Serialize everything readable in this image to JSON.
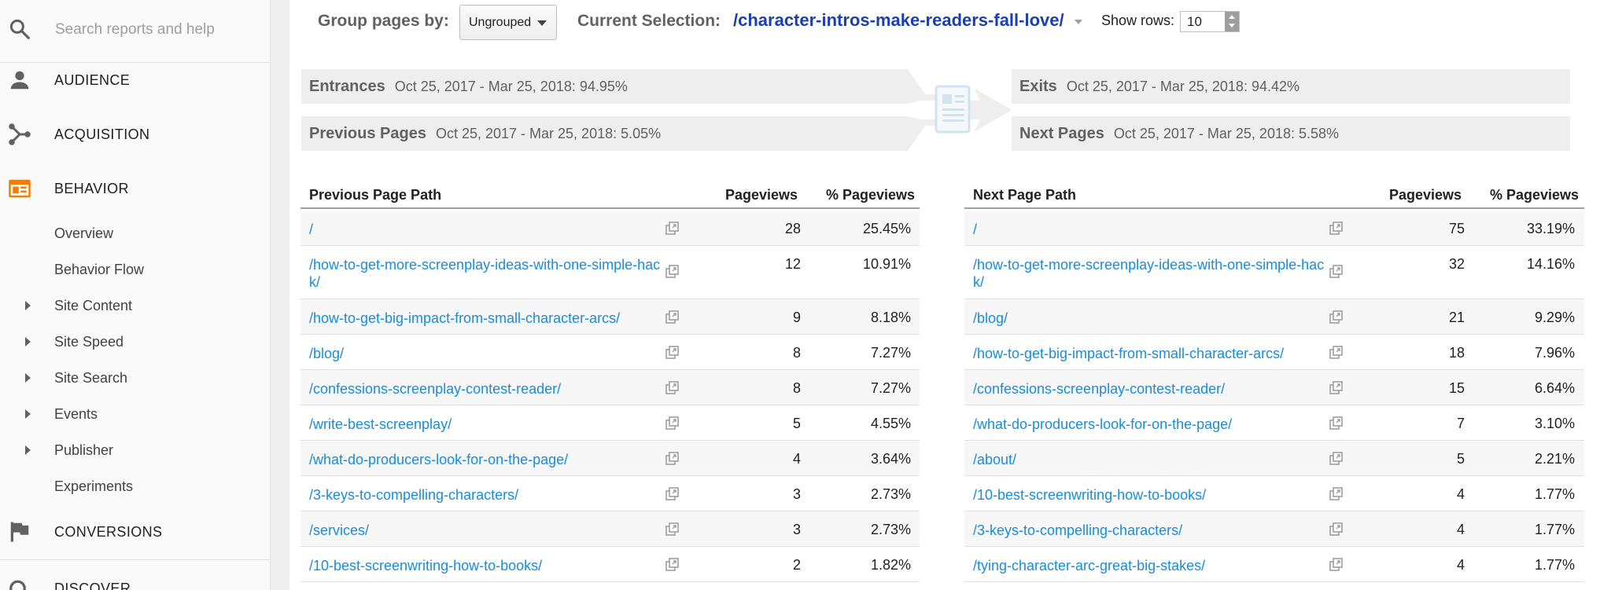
{
  "sidebar": {
    "search_placeholder": "Search reports and help",
    "sections": [
      {
        "label": "AUDIENCE"
      },
      {
        "label": "ACQUISITION"
      },
      {
        "label": "BEHAVIOR"
      },
      {
        "label": "CONVERSIONS"
      },
      {
        "label": "DISCOVER"
      }
    ],
    "behavior_items": [
      {
        "label": "Overview",
        "expandable": false
      },
      {
        "label": "Behavior Flow",
        "expandable": false
      },
      {
        "label": "Site Content",
        "expandable": true
      },
      {
        "label": "Site Speed",
        "expandable": true
      },
      {
        "label": "Site Search",
        "expandable": true
      },
      {
        "label": "Events",
        "expandable": true
      },
      {
        "label": "Publisher",
        "expandable": true
      },
      {
        "label": "Experiments",
        "expandable": false
      }
    ],
    "accent_color": "#f57c00"
  },
  "toolbar": {
    "group_label": "Group pages by:",
    "group_value": "Ungrouped",
    "current_label": "Current Selection:",
    "current_value": "/character-intros-make-readers-fall-love/",
    "rows_label": "Show rows:",
    "rows_value": "10"
  },
  "summary": {
    "entrances_title": "Entrances",
    "entrances_value": "Oct 25, 2017 - Mar 25, 2018: 94.95%",
    "previous_title": "Previous Pages",
    "previous_value": "Oct 25, 2017 - Mar 25, 2018: 5.05%",
    "exits_title": "Exits",
    "exits_value": "Oct 25, 2017 - Mar 25, 2018: 94.42%",
    "next_title": "Next Pages",
    "next_value": "Oct 25, 2017 - Mar 25, 2018: 5.58%"
  },
  "previous_table": {
    "headers": {
      "path": "Previous Page Path",
      "pageviews": "Pageviews",
      "pct": "% Pageviews"
    },
    "rows": [
      {
        "path": "/",
        "pageviews": "28",
        "pct": "25.45%"
      },
      {
        "path": "/how-to-get-more-screenplay-ideas-with-one-simple-hack/",
        "pageviews": "12",
        "pct": "10.91%"
      },
      {
        "path": "/how-to-get-big-impact-from-small-character-arcs/",
        "pageviews": "9",
        "pct": "8.18%"
      },
      {
        "path": "/blog/",
        "pageviews": "8",
        "pct": "7.27%"
      },
      {
        "path": "/confessions-screenplay-contest-reader/",
        "pageviews": "8",
        "pct": "7.27%"
      },
      {
        "path": "/write-best-screenplay/",
        "pageviews": "5",
        "pct": "4.55%"
      },
      {
        "path": "/what-do-producers-look-for-on-the-page/",
        "pageviews": "4",
        "pct": "3.64%"
      },
      {
        "path": "/3-keys-to-compelling-characters/",
        "pageviews": "3",
        "pct": "2.73%"
      },
      {
        "path": "/services/",
        "pageviews": "3",
        "pct": "2.73%"
      },
      {
        "path": "/10-best-screenwriting-how-to-books/",
        "pageviews": "2",
        "pct": "1.82%"
      }
    ]
  },
  "next_table": {
    "headers": {
      "path": "Next Page Path",
      "pageviews": "Pageviews",
      "pct": "% Pageviews"
    },
    "rows": [
      {
        "path": "/",
        "pageviews": "75",
        "pct": "33.19%"
      },
      {
        "path": "/how-to-get-more-screenplay-ideas-with-one-simple-hack/",
        "pageviews": "32",
        "pct": "14.16%"
      },
      {
        "path": "/blog/",
        "pageviews": "21",
        "pct": "9.29%"
      },
      {
        "path": "/how-to-get-big-impact-from-small-character-arcs/",
        "pageviews": "18",
        "pct": "7.96%"
      },
      {
        "path": "/confessions-screenplay-contest-reader/",
        "pageviews": "15",
        "pct": "6.64%"
      },
      {
        "path": "/what-do-producers-look-for-on-the-page/",
        "pageviews": "7",
        "pct": "3.10%"
      },
      {
        "path": "/about/",
        "pageviews": "5",
        "pct": "2.21%"
      },
      {
        "path": "/10-best-screenwriting-how-to-books/",
        "pageviews": "4",
        "pct": "1.77%"
      },
      {
        "path": "/3-keys-to-compelling-characters/",
        "pageviews": "4",
        "pct": "1.77%"
      },
      {
        "path": "/tying-character-arc-great-big-stakes/",
        "pageviews": "4",
        "pct": "1.77%"
      }
    ]
  }
}
